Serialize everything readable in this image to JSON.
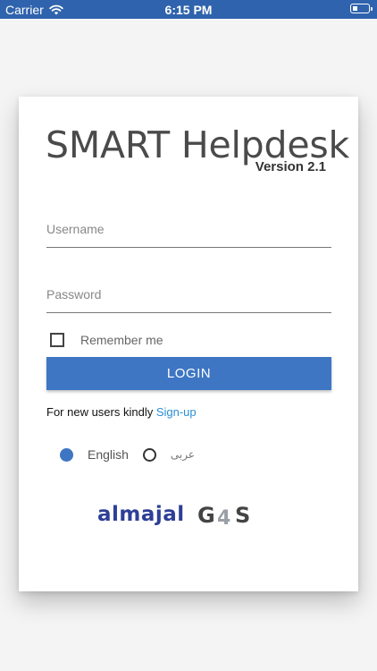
{
  "status_bar": {
    "carrier": "Carrier",
    "time": "6:15 PM"
  },
  "app": {
    "title": "SMART Helpdesk",
    "version": "Version 2.1"
  },
  "form": {
    "username_placeholder": "Username",
    "password_placeholder": "Password",
    "remember_label": "Remember me",
    "login_label": "LOGIN",
    "signup_prefix": "For new users kindly ",
    "signup_link": "Sign-up"
  },
  "language": {
    "options": [
      "English",
      "عربى"
    ],
    "selected": "English"
  },
  "logos": {
    "almajal": "almajal",
    "g4s": "G4S"
  },
  "colors": {
    "status_bar": "#2f63ad",
    "primary": "#3e76c3",
    "link": "#2a8fd6"
  }
}
